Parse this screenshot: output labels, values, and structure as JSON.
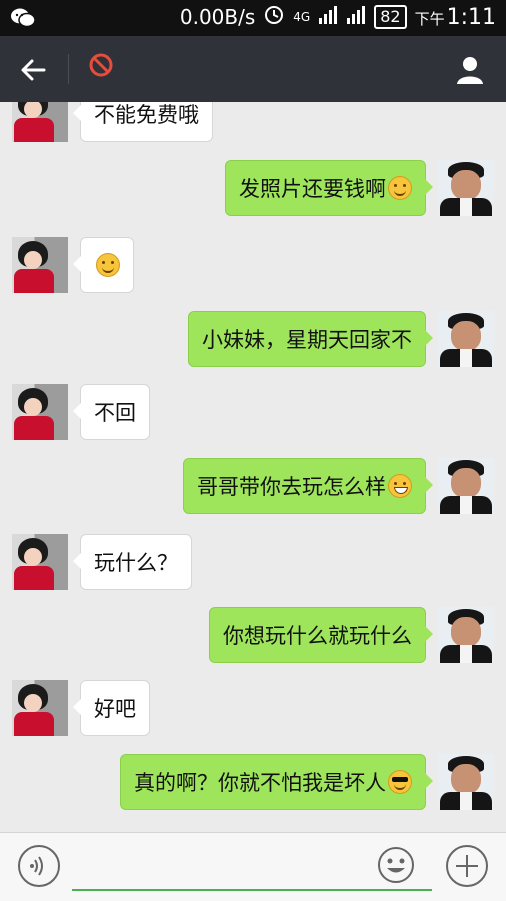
{
  "status_bar": {
    "net_speed": "0.00B/s",
    "network": "4G",
    "battery": "82",
    "period": "下午",
    "time": "1:11"
  },
  "header": {
    "back_icon": "arrow-left-icon",
    "mute_icon": "do-not-disturb-icon",
    "profile_icon": "user-icon"
  },
  "messages": [
    {
      "from": "them",
      "text": "不能免费哦"
    },
    {
      "from": "me",
      "text": "发照片还要钱啊",
      "emoji": "thinking-emoji"
    },
    {
      "from": "them",
      "text": "",
      "emoji": "smile-emoji"
    },
    {
      "from": "me",
      "text": "小妹妹，星期天回家不"
    },
    {
      "from": "them",
      "text": "不回"
    },
    {
      "from": "me",
      "text": "哥哥带你去玩怎么样",
      "emoji": "grin-emoji"
    },
    {
      "from": "them",
      "text": "玩什么？"
    },
    {
      "from": "me",
      "text": "你想玩什么就玩什么"
    },
    {
      "from": "them",
      "text": "好吧"
    },
    {
      "from": "me",
      "text": "真的啊？你就不怕我是坏人",
      "emoji": "cool-emoji"
    }
  ],
  "input_bar": {
    "placeholder": "",
    "voice_icon": "voice-icon",
    "emoji_icon": "emoji-icon",
    "plus_icon": "plus-icon"
  }
}
